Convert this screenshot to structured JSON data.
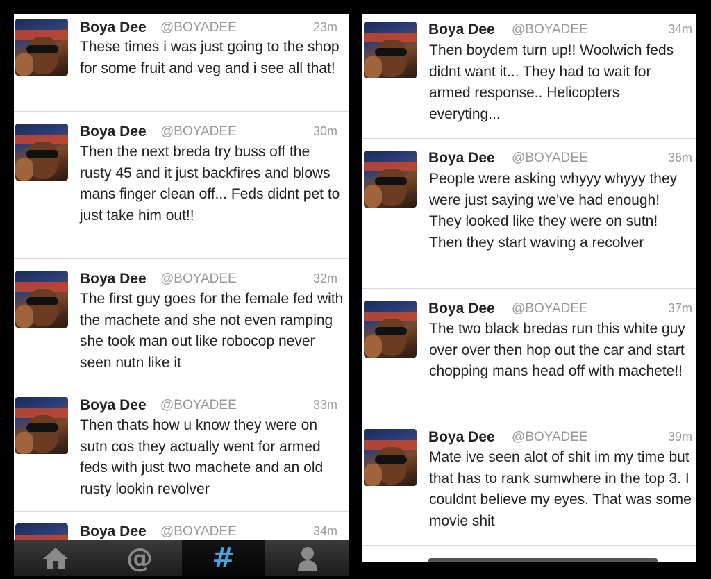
{
  "left_panel": {
    "tweets": [
      {
        "name": "Boya Dee",
        "handle": "@BOYADEE",
        "time": "23m",
        "text": "These times i was just going to the shop for some fruit and veg and i see all that!"
      },
      {
        "name": "Boya Dee",
        "handle": "@BOYADEE",
        "time": "30m",
        "text": "Then the next breda try buss off the rusty 45 and it just backfires and blows mans finger clean off... Feds didnt pet to just take him out!!"
      },
      {
        "name": "Boya Dee",
        "handle": "@BOYADEE",
        "time": "32m",
        "text": "The first guy goes for the female fed with the machete and she not even ramping she took man out like robocop never seen nutn like it"
      },
      {
        "name": "Boya Dee",
        "handle": "@BOYADEE",
        "time": "33m",
        "text": "Then thats how u know they were on sutn cos they actually went for armed feds with just two machete and an old rusty lookin revolver"
      },
      {
        "name": "Boya Dee",
        "handle": "@BOYADEE",
        "time": "34m",
        "text": ""
      }
    ]
  },
  "right_panel": {
    "tweets": [
      {
        "name": "Boya Dee",
        "handle": "@BOYADEE",
        "time": "34m",
        "text": "Then boydem turn up!! Woolwich feds didnt want it... They had to wait for armed response.. Helicopters everyting..."
      },
      {
        "name": "Boya Dee",
        "handle": "@BOYADEE",
        "time": "36m",
        "text": "People were asking whyyy whyyy they were just saying we've had enough! They looked like they were on sutn! Then they start waving a recolver"
      },
      {
        "name": "Boya Dee",
        "handle": "@BOYADEE",
        "time": "37m",
        "text": "The two black bredas run this white guy over over then hop out the car and start chopping mans head off with machete!!"
      },
      {
        "name": "Boya Dee",
        "handle": "@BOYADEE",
        "time": "39m",
        "text": "Mate ive seen alot of shit im my time but that has to rank sumwhere in the top 3. I couldnt believe my eyes. That was some movie shit"
      }
    ]
  },
  "tab_bar": {
    "tabs": [
      {
        "icon": "home-icon"
      },
      {
        "icon": "mentions-icon",
        "glyph": "@"
      },
      {
        "icon": "discover-hashtag-icon",
        "glyph": "#",
        "active": true
      },
      {
        "icon": "profile-icon"
      }
    ],
    "active_color": "#4aa3df"
  }
}
